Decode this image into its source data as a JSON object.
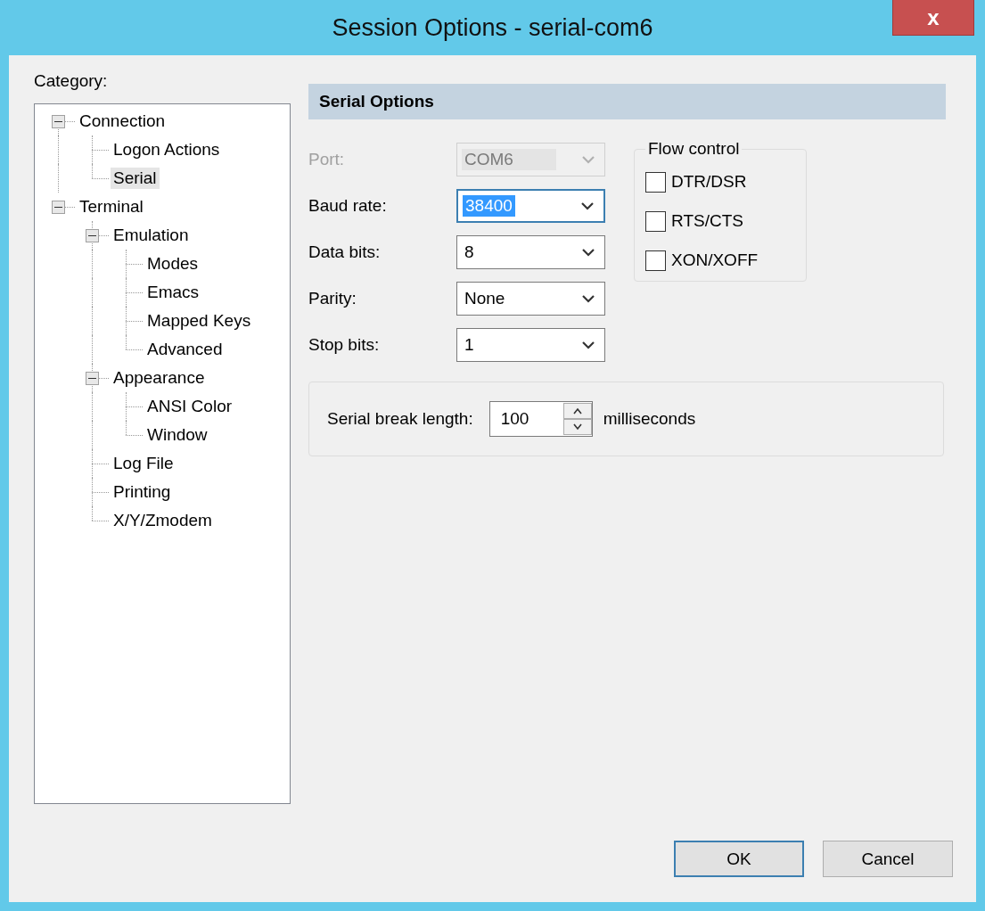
{
  "window": {
    "title": "Session Options - serial-com6",
    "close": "x"
  },
  "category_label": "Category:",
  "tree": [
    {
      "label": "Connection",
      "expanded": true,
      "selected": false,
      "children": [
        {
          "label": "Logon Actions",
          "selected": false
        },
        {
          "label": "Serial",
          "selected": true
        }
      ]
    },
    {
      "label": "Terminal",
      "expanded": true,
      "selected": false,
      "children": [
        {
          "label": "Emulation",
          "expanded": true,
          "selected": false,
          "children": [
            {
              "label": "Modes",
              "selected": false
            },
            {
              "label": "Emacs",
              "selected": false
            },
            {
              "label": "Mapped Keys",
              "selected": false
            },
            {
              "label": "Advanced",
              "selected": false
            }
          ]
        },
        {
          "label": "Appearance",
          "expanded": true,
          "selected": false,
          "children": [
            {
              "label": "ANSI Color",
              "selected": false
            },
            {
              "label": "Window",
              "selected": false
            }
          ]
        },
        {
          "label": "Log File",
          "selected": false
        },
        {
          "label": "Printing",
          "selected": false
        },
        {
          "label": "X/Y/Zmodem",
          "selected": false
        }
      ]
    }
  ],
  "section_title": "Serial Options",
  "fields": [
    {
      "label": "Port:",
      "value": "COM6",
      "disabled": true,
      "focused": false
    },
    {
      "label": "Baud rate:",
      "value": "38400",
      "disabled": false,
      "focused": true
    },
    {
      "label": "Data bits:",
      "value": "8",
      "disabled": false,
      "focused": false
    },
    {
      "label": "Parity:",
      "value": "None",
      "disabled": false,
      "focused": false
    },
    {
      "label": "Stop bits:",
      "value": "1",
      "disabled": false,
      "focused": false
    }
  ],
  "flow_control": {
    "title": "Flow control",
    "options": [
      {
        "label": "DTR/DSR",
        "checked": false
      },
      {
        "label": "RTS/CTS",
        "checked": false
      },
      {
        "label": "XON/XOFF",
        "checked": false
      }
    ]
  },
  "serial_break": {
    "label": "Serial break length:",
    "value": "100",
    "unit": "milliseconds"
  },
  "buttons": [
    {
      "label": "OK",
      "default": true
    },
    {
      "label": "Cancel",
      "default": false
    }
  ]
}
